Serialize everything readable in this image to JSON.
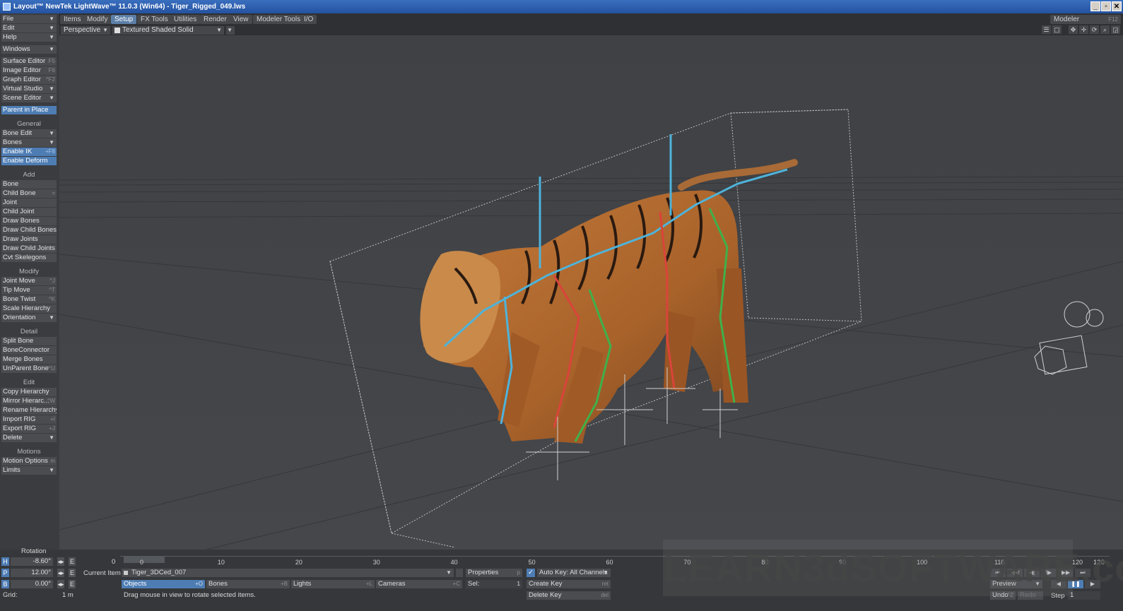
{
  "window": {
    "title": "Layout™ NewTek LightWave™ 11.0.3 (Win64) - Tiger_Rigged_049.lws",
    "controls": [
      "_",
      "▫",
      "✕"
    ]
  },
  "tabs": [
    "Items",
    "Modify",
    "Setup",
    "FX Tools",
    "Utilities",
    "Render",
    "View",
    "Modeler Tools",
    "I/O"
  ],
  "active_tab": "Setup",
  "modeler_btn": {
    "label": "Modeler",
    "shortcut": "F12"
  },
  "viewport": {
    "view_mode": "Perspective",
    "shading": "Textured Shaded Solid"
  },
  "sidebar": {
    "file": "File",
    "edit": "Edit",
    "help": "Help",
    "windows": "Windows",
    "surface_editor": {
      "label": "Surface Editor",
      "sc": "F5"
    },
    "image_editor": {
      "label": "Image Editor",
      "sc": "F6"
    },
    "graph_editor": {
      "label": "Graph Editor",
      "sc": "^F2"
    },
    "virtual_studio": "Virtual Studio",
    "scene_editor": "Scene Editor",
    "parent_in_place": "Parent in Place",
    "general_head": "General",
    "bone_edit": "Bone Edit",
    "bones": "Bones",
    "enable_ik": {
      "label": "Enable IK",
      "sc": "+F8"
    },
    "enable_deform": "Enable Deform",
    "add_head": "Add",
    "add": [
      {
        "label": "Bone",
        "sc": ""
      },
      {
        "label": "Child Bone",
        "sc": "="
      },
      {
        "label": "Joint",
        "sc": ""
      },
      {
        "label": "Child Joint",
        "sc": ""
      },
      {
        "label": "Draw Bones",
        "sc": ""
      },
      {
        "label": "Draw Child Bones",
        "sc": ""
      },
      {
        "label": "Draw Joints",
        "sc": ""
      },
      {
        "label": "Draw Child Joints",
        "sc": ""
      },
      {
        "label": "Cvt Skelegons",
        "sc": ""
      }
    ],
    "modify_head": "Modify",
    "modify": [
      {
        "label": "Joint Move",
        "sc": "^J"
      },
      {
        "label": "Tip Move",
        "sc": "^T"
      },
      {
        "label": "Bone Twist",
        "sc": "^K"
      },
      {
        "label": "Scale Hierarchy",
        "sc": ""
      }
    ],
    "orientation": "Orientation",
    "detail_head": "Detail",
    "detail": [
      {
        "label": "Split Bone",
        "sc": ""
      },
      {
        "label": "BoneConnector",
        "sc": ""
      },
      {
        "label": "Merge Bones",
        "sc": ""
      },
      {
        "label": "UnParent Bone",
        "sc": "^U"
      }
    ],
    "edit_head": "Edit",
    "edit_items": [
      {
        "label": "Copy Hierarchy",
        "sc": ""
      },
      {
        "label": "Mirror Hierarc...",
        "sc": "^W"
      },
      {
        "label": "Rename Hierarchy",
        "sc": ""
      },
      {
        "label": "Import RIG",
        "sc": "+I"
      },
      {
        "label": "Export RIG",
        "sc": "+J"
      }
    ],
    "delete": "Delete",
    "motions_head": "Motions",
    "motion_options": {
      "label": "Motion Options",
      "sc": "m"
    },
    "limits": "Limits"
  },
  "bottom": {
    "rotation_label": "Rotation",
    "h_label": "H",
    "h_value": "-8.60°",
    "p_label": "P",
    "p_value": "12.00°",
    "b_label": "B",
    "b_value": "0.00°",
    "e_label": "E",
    "grid_label": "Grid:",
    "grid_value": "1 m",
    "timeline_start": "0",
    "ticks": [
      "0",
      "10",
      "20",
      "30",
      "40",
      "50",
      "60",
      "70",
      "80",
      "90",
      "100",
      "110",
      "120"
    ],
    "timeline_end": "120",
    "current_item_label": "Current Item",
    "current_item": "Tiger_3DCed_007",
    "properties": {
      "label": "Properties",
      "sc": "p"
    },
    "auto_key": "Auto Key: All Channels",
    "objects": {
      "label": "Objects",
      "sc": "+O"
    },
    "bones": {
      "label": "Bones",
      "sc": "+B"
    },
    "lights": {
      "label": "Lights",
      "sc": "+L"
    },
    "cameras": {
      "label": "Cameras",
      "sc": "+C"
    },
    "sel_label": "Sel:",
    "sel_value": "1",
    "create_key": {
      "label": "Create Key",
      "sc": "ret"
    },
    "delete_key": {
      "label": "Delete Key",
      "sc": "del"
    },
    "status": "Drag mouse in view to rotate selected items.",
    "preview": "Preview",
    "undo": "Undo",
    "undo_sc": "^Z",
    "redo": "Redo",
    "step_label": "Step",
    "step_value": "1"
  },
  "watermark": "LEARN3dSOFTWARE.com",
  "colors": {
    "accent_blue": "#4e7db4",
    "viewport_bg": "#434549",
    "bone_blue": "#4fb3d9",
    "bone_green": "#3fb04a",
    "bone_red": "#d9443a",
    "tiger_orange": "#b86a2e"
  }
}
